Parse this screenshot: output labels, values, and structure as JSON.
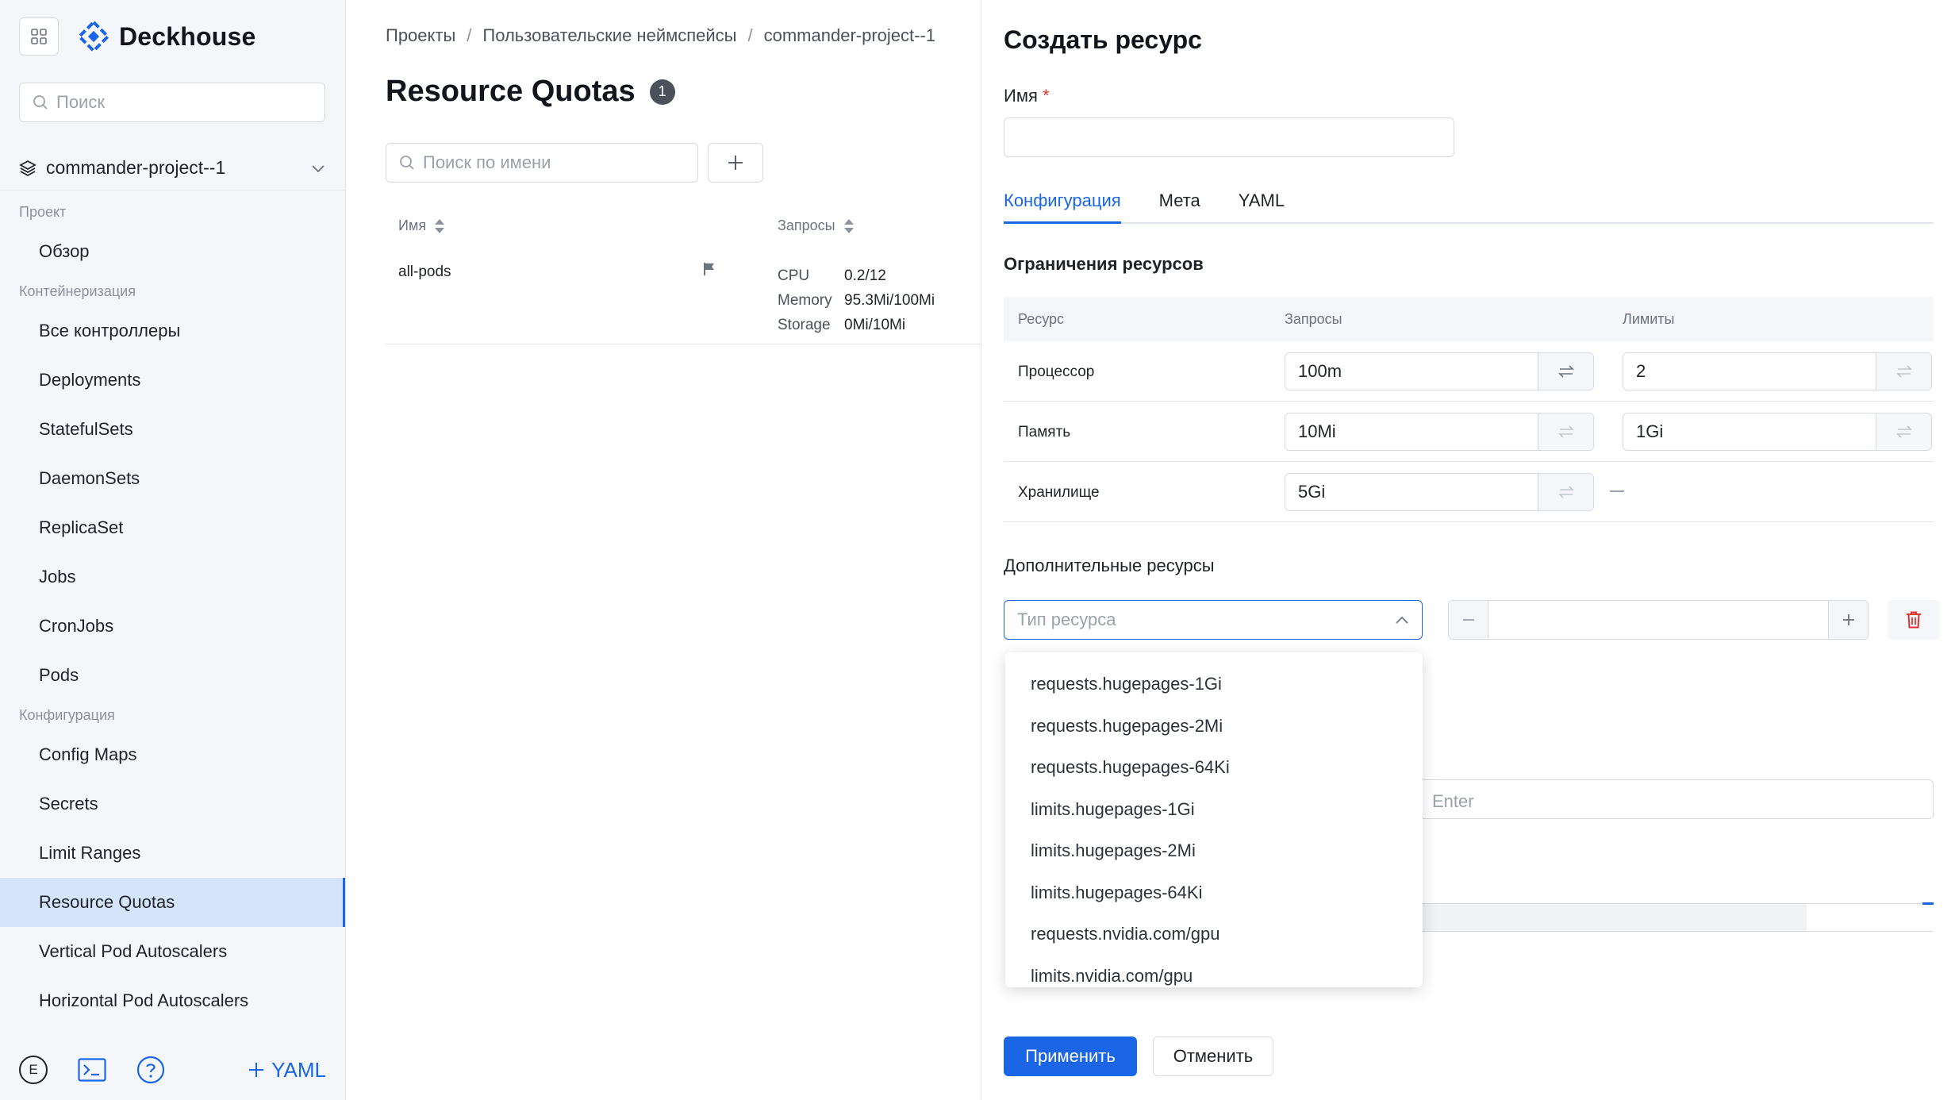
{
  "app": {
    "logo_text": "Deckhouse"
  },
  "sidebar": {
    "search_placeholder": "Поиск",
    "project": "commander-project--1",
    "groups": [
      {
        "label": "Проект",
        "items": [
          "Обзор"
        ]
      },
      {
        "label": "Контейнеризация",
        "items": [
          "Все контроллеры",
          "Deployments",
          "StatefulSets",
          "DaemonSets",
          "ReplicaSet",
          "Jobs",
          "CronJobs",
          "Pods"
        ]
      },
      {
        "label": "Конфигурация",
        "items": [
          "Config Maps",
          "Secrets",
          "Limit Ranges",
          "Resource Quotas",
          "Vertical Pod Autoscalers",
          "Horizontal Pod Autoscalers"
        ]
      }
    ],
    "active_item": "Resource Quotas",
    "footer": {
      "avatar_letter": "E",
      "yaml_label": "YAML"
    }
  },
  "list": {
    "breadcrumb": [
      "Проекты",
      "Пользовательские неймспейсы",
      "commander-project--1"
    ],
    "title": "Resource Quotas",
    "count": "1",
    "search_placeholder": "Поиск по имени",
    "columns": {
      "name": "Имя",
      "requests": "Запросы"
    },
    "rows": [
      {
        "name": "all-pods",
        "quotas": [
          {
            "key": "CPU",
            "value": "0.2/12"
          },
          {
            "key": "Memory",
            "value": "95.3Mi/100Mi"
          },
          {
            "key": "Storage",
            "value": "0Mi/10Mi"
          }
        ]
      }
    ]
  },
  "panel": {
    "title": "Создать ресурс",
    "name_label": "Имя",
    "required_mark": "*",
    "tabs": [
      "Конфигурация",
      "Мета",
      "YAML"
    ],
    "active_tab": "Конфигурация",
    "limits_section": "Ограничения ресурсов",
    "limits_table": {
      "headers": {
        "resource": "Ресурс",
        "requests": "Запросы",
        "limits": "Лимиты"
      },
      "rows": [
        {
          "resource": "Процессор",
          "request": "100m",
          "limit": "2"
        },
        {
          "resource": "Память",
          "request": "10Mi",
          "limit": "1Gi"
        },
        {
          "resource": "Хранилище",
          "request": "5Gi",
          "limit": "—"
        }
      ]
    },
    "extra_section": "Дополнительные ресурсы",
    "resource_type_placeholder": "Тип ресурса",
    "obscured_hint": "Enter",
    "dropdown_options": [
      "requests.hugepages-1Gi",
      "requests.hugepages-2Mi",
      "requests.hugepages-64Ki",
      "limits.hugepages-1Gi",
      "limits.hugepages-2Mi",
      "limits.hugepages-64Ki",
      "requests.nvidia.com/gpu",
      "limits.nvidia.com/gpu"
    ],
    "apply_label": "Применить",
    "cancel_label": "Отменить"
  },
  "colors": {
    "accent": "#1a66e6",
    "active_nav": "#d6e4fb",
    "danger": "#e0342f"
  }
}
